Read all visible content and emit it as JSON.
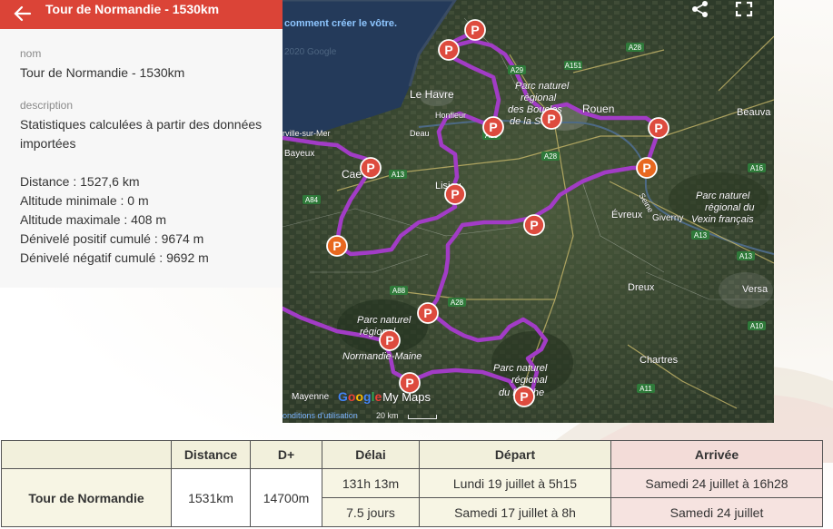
{
  "header": {
    "title": "Tour de Normandie - 1530km"
  },
  "panel": {
    "name_label": "nom",
    "name_value": "Tour de Normandie - 1530km",
    "description_label": "description",
    "description_value": "Statistiques calculées à partir des données importées",
    "stats": [
      "Distance : 1527,6 km",
      "Altitude minimale : 0 m",
      "Altitude maximale : 408 m",
      "Dénivelé positif cumulé : 9674 m",
      "Dénivelé négatif cumulé : 9692 m"
    ]
  },
  "map": {
    "top_text": "comment créer le vôtre.",
    "copyright": "2020 Google",
    "terms": "onditions d'utilisation",
    "scale": "20 km",
    "logo_letters": [
      "G",
      "o",
      "o",
      "g",
      "l",
      "e"
    ],
    "logo_suffix": "My Maps",
    "labels": [
      {
        "id": "le-havre",
        "text": "Le Havre"
      },
      {
        "id": "rouen",
        "text": "Rouen"
      },
      {
        "id": "beauvais",
        "text": "Beauva"
      },
      {
        "id": "bayeux",
        "text": "Bayeux"
      },
      {
        "id": "caen",
        "text": "Cae"
      },
      {
        "id": "lisieux",
        "text": "Lisieu"
      },
      {
        "id": "evreux",
        "text": "Évreux"
      },
      {
        "id": "giverny",
        "text": "Giverny"
      },
      {
        "id": "dreux",
        "text": "Dreux"
      },
      {
        "id": "versailles",
        "text": "Versa"
      },
      {
        "id": "chartres",
        "text": "Chartres"
      },
      {
        "id": "mayenne",
        "text": "Mayenne"
      },
      {
        "id": "honfleur",
        "text": "Honfleur"
      },
      {
        "id": "deauville",
        "text": "Deau"
      },
      {
        "id": "arville",
        "text": "rville-sur-Mer"
      },
      {
        "id": "pnr-seine1",
        "text": "Parc naturel"
      },
      {
        "id": "pnr-seine2",
        "text": "régional"
      },
      {
        "id": "pnr-seine3",
        "text": "des Boucles"
      },
      {
        "id": "pnr-seine4",
        "text": "de la Seine"
      },
      {
        "id": "pnr-vexin1",
        "text": "Parc naturel"
      },
      {
        "id": "pnr-vexin2",
        "text": "régional du"
      },
      {
        "id": "pnr-vexin3",
        "text": "Vexin français"
      },
      {
        "id": "pnr-nm1",
        "text": "Parc naturel"
      },
      {
        "id": "pnr-nm2",
        "text": "régional"
      },
      {
        "id": "pnr-nm3",
        "text": "Normandie-Maine"
      },
      {
        "id": "pnr-perche1",
        "text": "Parc naturel"
      },
      {
        "id": "pnr-perche2",
        "text": "régional"
      },
      {
        "id": "pnr-perche3",
        "text": "du Perche"
      },
      {
        "id": "seine-river",
        "text": "Seine"
      }
    ],
    "roads": [
      "A28",
      "A29",
      "A151",
      "A13",
      "A84",
      "A88",
      "A28",
      "A16",
      "A13",
      "A13",
      "A10",
      "A11",
      "A13",
      "A28"
    ],
    "marker_letter": "P"
  },
  "table": {
    "headers": [
      "",
      "Distance",
      "D+",
      "Délai",
      "Départ",
      "Arrivée"
    ],
    "row_label": "Tour de Normandie",
    "distance": "1531km",
    "dplus": "14700m",
    "rows": [
      {
        "delai": "131h 13m",
        "depart": "Lundi 19 juillet à 5h15",
        "arrivee": "Samedi 24 juillet à 16h28"
      },
      {
        "delai": "7.5 jours",
        "depart": "Samedi 17 juillet à 8h",
        "arrivee": "Samedi 24 juillet"
      }
    ]
  },
  "colors": {
    "header_red": "#db4437",
    "route_purple": "#a23cc6",
    "marker_red": "#dd4b3e",
    "marker_orange": "#e8681f"
  }
}
